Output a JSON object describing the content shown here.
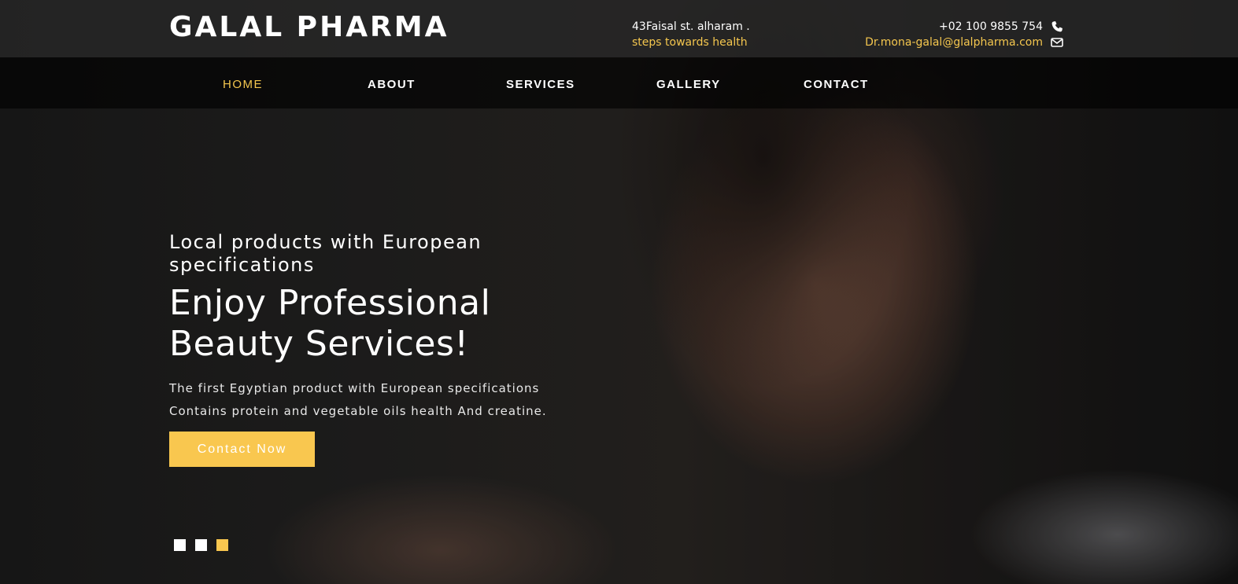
{
  "header": {
    "brand": "GALAL PHARMA",
    "address_line": "43Faisal st. alharam .",
    "tagline": "steps towards health",
    "phone": "+02 100 9855 754",
    "email": "Dr.mona-galal@glalpharma.com",
    "phone_icon": "phone-icon",
    "email_icon": "envelope-icon"
  },
  "nav": {
    "items": [
      {
        "label": "HOME",
        "active": true
      },
      {
        "label": "ABOUT",
        "active": false
      },
      {
        "label": "SERVICES",
        "active": false
      },
      {
        "label": "GALLERY",
        "active": false
      },
      {
        "label": "CONTACT",
        "active": false
      }
    ]
  },
  "hero": {
    "subtitle": "Local products with European specifications",
    "title": "Enjoy Professional Beauty Services!",
    "description_line1": "The first Egyptian product with European specifications",
    "description_line2": "Contains protein and vegetable oils health And creatine.",
    "cta_label": "Contact Now",
    "slides": 3,
    "active_slide": 3
  },
  "colors": {
    "accent": "#f9c74f",
    "topbar": "#282828",
    "navbar": "#000000"
  }
}
